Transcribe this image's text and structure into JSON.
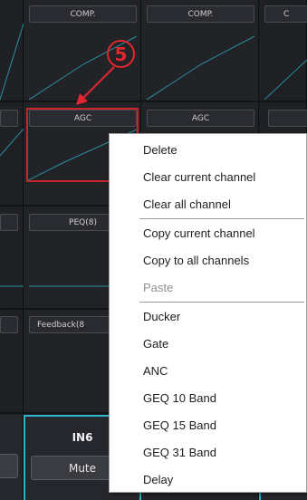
{
  "columns": {
    "comp_labels": [
      "COMP.",
      "COMP.",
      "C"
    ],
    "agc_labels": [
      "AGC",
      "AGC"
    ],
    "peq_label": "PEQ(8)",
    "feedback_label": "Feedback(8"
  },
  "marker": {
    "number": "5"
  },
  "channel_strip": {
    "title": "IN6",
    "mute_label": "Mute"
  },
  "context_menu": {
    "items": [
      {
        "label": "Delete",
        "enabled": true
      },
      {
        "label": "Clear current channel",
        "enabled": true
      },
      {
        "label": "Clear all channel",
        "enabled": true
      },
      {
        "label": "Copy current channel",
        "enabled": true
      },
      {
        "label": "Copy to all channels",
        "enabled": true
      },
      {
        "label": "Paste",
        "enabled": false
      },
      {
        "label": "Ducker",
        "enabled": true
      },
      {
        "label": "Gate",
        "enabled": true
      },
      {
        "label": "ANC",
        "enabled": true
      },
      {
        "label": "GEQ 10 Band",
        "enabled": true
      },
      {
        "label": "GEQ 15 Band",
        "enabled": true
      },
      {
        "label": "GEQ 31 Band",
        "enabled": true
      },
      {
        "label": "Delay",
        "enabled": true
      }
    ]
  },
  "colors": {
    "highlight_red": "#c4262b",
    "strip_accent": "#2bb3c8",
    "graph_line": "#2a8fa0"
  }
}
